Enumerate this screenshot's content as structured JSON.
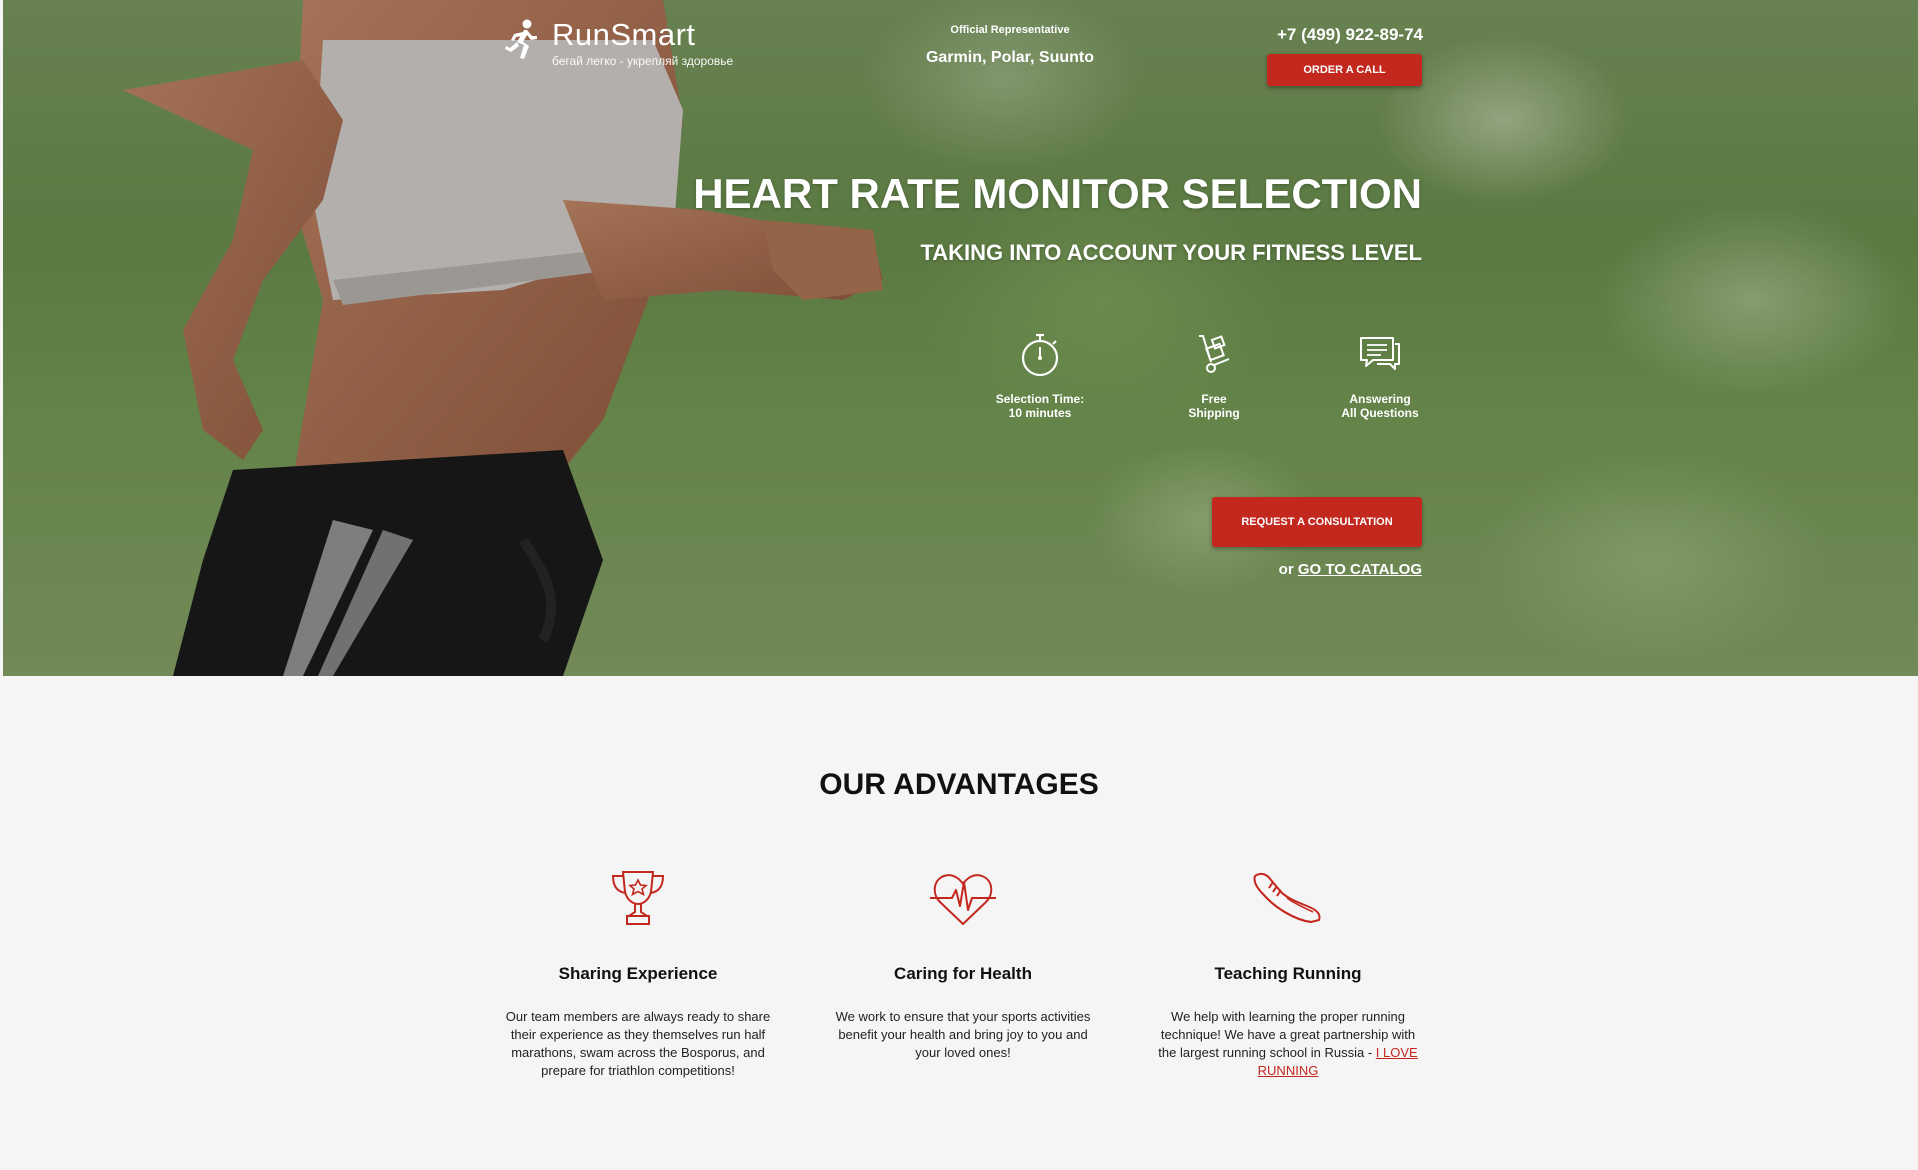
{
  "brand": {
    "name": "RunSmart",
    "slogan": "бегай легко - укрепляй здоровье",
    "logo_icon": "runner-icon"
  },
  "header": {
    "official_label": "Official Representative",
    "official_brands": "Garmin, Polar, Suunto",
    "phone": "+7 (499) 922-89-74",
    "order_call_label": "ORDER A CALL"
  },
  "hero": {
    "title": "HEART RATE MONITOR SELECTION",
    "subtitle": "TAKING INTO ACCOUNT YOUR FITNESS LEVEL",
    "features": [
      {
        "icon": "stopwatch-icon",
        "line1": "Selection Time:",
        "line2": "10 minutes"
      },
      {
        "icon": "hand-truck-icon",
        "line1": "Free",
        "line2": "Shipping"
      },
      {
        "icon": "chat-icon",
        "line1": "Answering",
        "line2": "All Questions"
      }
    ],
    "consult_label": "REQUEST A CONSULTATION",
    "catalog_prefix": "or ",
    "catalog_link": "GO TO CATALOG"
  },
  "advantages": {
    "title": "OUR ADVANTAGES",
    "items": [
      {
        "icon": "trophy-icon",
        "title": "Sharing Experience",
        "text": "Our team members are always ready to share their experience as they themselves run half marathons, swam across the Bosporus, and prepare for triathlon competitions!"
      },
      {
        "icon": "heartbeat-icon",
        "title": "Caring for Health",
        "text": "We work to ensure that your sports activities benefit your health and bring joy to you and your loved ones!"
      },
      {
        "icon": "sneaker-icon",
        "title": "Teaching Running",
        "text": "We help with learning the proper running technique! We have a great partnership with the largest running school in Russia - ",
        "link": "I LOVE RUNNING"
      }
    ]
  },
  "colors": {
    "accent": "#c3281e",
    "page_bg": "#f5f5f5"
  }
}
